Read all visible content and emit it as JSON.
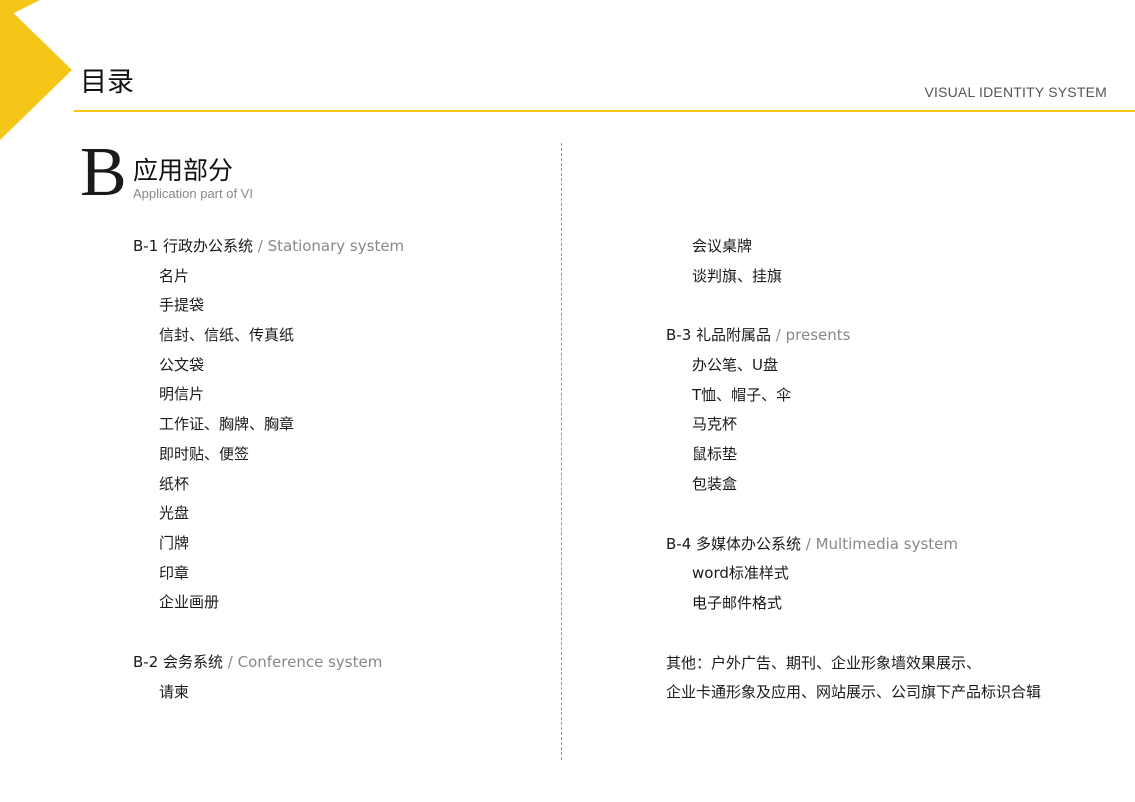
{
  "header": {
    "title": "目录",
    "system_label": "VISUAL IDENTITY SYSTEM",
    "accent_color": "#f5c518"
  },
  "section": {
    "letter": "B",
    "title": "应用部分",
    "subtitle": "Application part of VI"
  },
  "left_column": {
    "groups": [
      {
        "code": "B-1 行政办公系统",
        "en": " / Stationary system",
        "items": [
          "名片",
          "手提袋",
          "信封、信纸、传真纸",
          "公文袋",
          "明信片",
          "工作证、胸牌、胸章",
          "即时贴、便签",
          "纸杯",
          "光盘",
          "门牌",
          "印章",
          "企业画册"
        ]
      },
      {
        "code": "B-2 会务系统",
        "en": " / Conference system",
        "items": [
          "请柬"
        ]
      }
    ]
  },
  "right_column": {
    "continued_items": [
      "会议桌牌",
      "谈判旗、挂旗"
    ],
    "groups": [
      {
        "code": "B-3 礼品附属品",
        "en": " / presents",
        "items": [
          "办公笔、U盘",
          "T恤、帽子、伞",
          "马克杯",
          "鼠标垫",
          "包装盒"
        ]
      },
      {
        "code": "B-4 多媒体办公系统",
        "en": " / Multimedia system",
        "items": [
          "word标准样式",
          "电子邮件格式"
        ]
      }
    ],
    "other": [
      "其他：户外广告、期刊、企业形象墙效果展示、",
      "企业卡通形象及应用、网站展示、公司旗下产品标识合辑"
    ]
  }
}
